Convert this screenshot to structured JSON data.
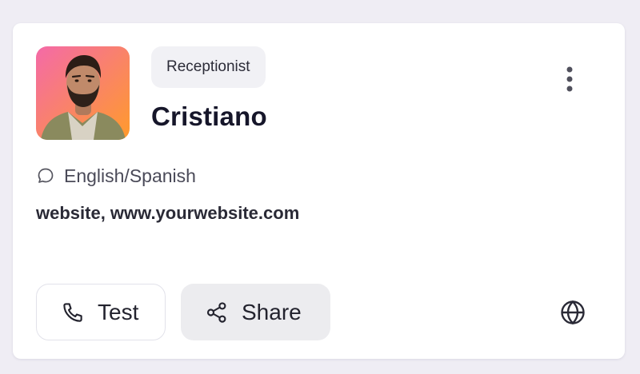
{
  "agent": {
    "role": "Receptionist",
    "name": "Cristiano",
    "language": "English/Spanish",
    "knowledge": "website, www.yourwebsite.com",
    "avatar_gradient": [
      "#f46aa8",
      "#ff9b2b"
    ]
  },
  "actions": {
    "test_label": "Test",
    "share_label": "Share"
  },
  "icons": {
    "more": "more-vertical-icon",
    "language": "chat-bubble-icon",
    "test": "phone-icon",
    "share": "share-icon",
    "website": "globe-icon"
  }
}
